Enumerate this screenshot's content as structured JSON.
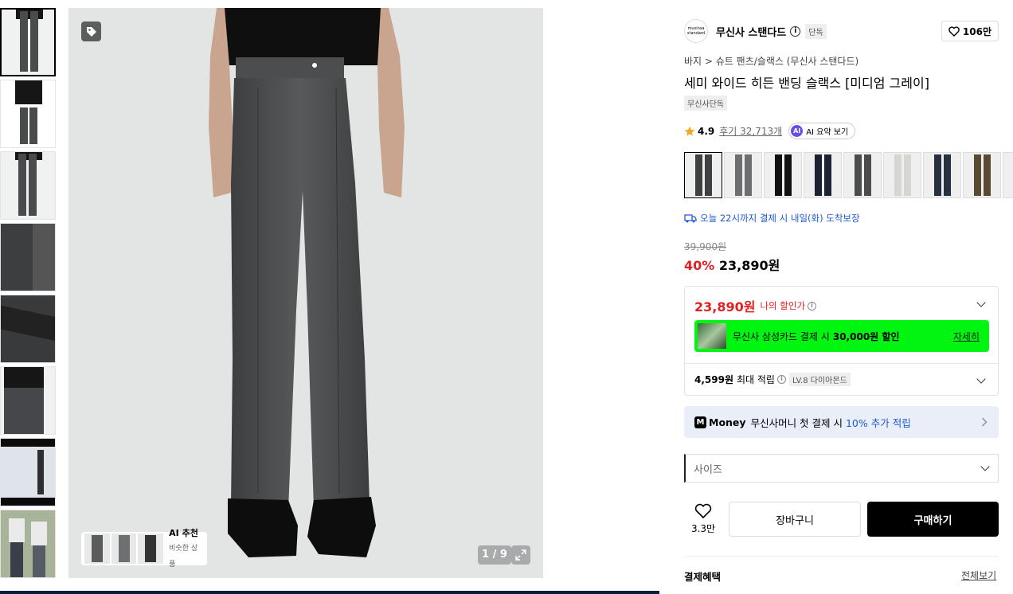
{
  "gallery": {
    "counter": "1 / 9",
    "ai_recommend": {
      "title": "AI 추천",
      "subtitle": "비슷한 상품"
    }
  },
  "brand": {
    "logo_text": "musinsa standard",
    "name": "무신사 스탠다드",
    "exclusive_tag": "단독",
    "like_count": "106만"
  },
  "breadcrumb": "바지 > 슈트 팬츠/슬랙스 (무신사 스탠다드)",
  "product": {
    "title": "세미 와이드 히든 밴딩 슬랙스 [미디엄 그레이]",
    "badge": "무신사단독",
    "rating": "4.9",
    "reviews": "후기 32,713개",
    "ai_summary": "AI 요약 보기",
    "ai_summary_icon": "AI"
  },
  "swatches": [
    {
      "color": "#3f4042",
      "active": true
    },
    {
      "color": "#6d6e70",
      "active": false
    },
    {
      "color": "#111111",
      "active": false
    },
    {
      "color": "#1b2233",
      "active": false
    },
    {
      "color": "#4a4d4b",
      "active": false
    },
    {
      "color": "#d6d6d3",
      "active": false
    },
    {
      "color": "#27303e",
      "active": false
    },
    {
      "color": "#5a4a32",
      "active": false
    },
    {
      "color": "#e6e6e6",
      "active": false
    }
  ],
  "delivery": "오늘 22시까지 결제 시 내일(화) 도착보장",
  "pricing": {
    "original": "39,900원",
    "discount_pct": "40%",
    "sale": "23,890원",
    "my_price": "23,890원",
    "my_price_label": "나의 할인가"
  },
  "card_promo": {
    "text": "무신사 삼성카드 결제 시",
    "amount": "30,000원 할인",
    "detail": "자세히"
  },
  "points": {
    "amount": "4,599원",
    "label": "최대 적립",
    "level": "LV.8 다이아몬드"
  },
  "money": {
    "icon": "M",
    "brand": "Money",
    "text": "무신사머니 첫 결제 시",
    "highlight": "10% 추가 적립"
  },
  "size_select": {
    "placeholder": "사이즈"
  },
  "actions": {
    "like_count": "3.3만",
    "cart": "장바구니",
    "buy": "구매하기"
  },
  "payment_benefits": {
    "title": "결제혜택",
    "view_all": "전체보기"
  },
  "colors": {
    "accent_red": "#e02020",
    "link_blue": "#1d5bd6",
    "promo_green": "#00f510"
  }
}
